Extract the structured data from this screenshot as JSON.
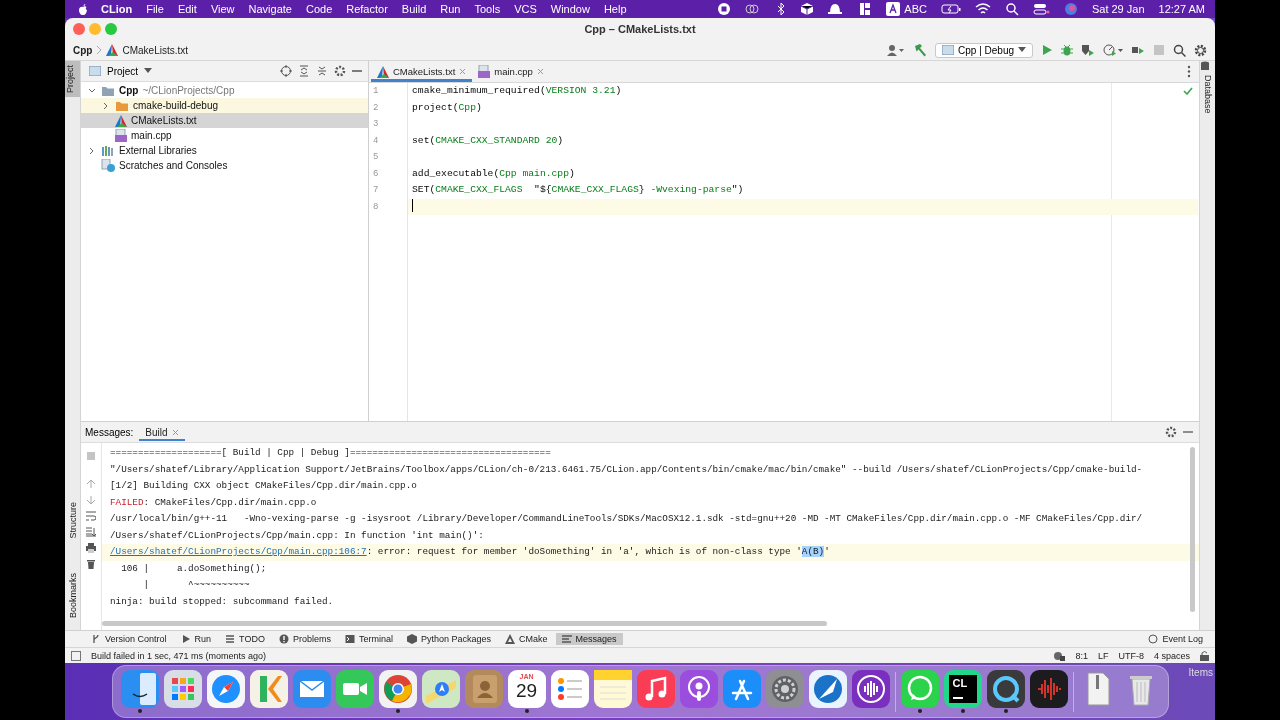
{
  "menu_bar": {
    "app_name": "CLion",
    "menus": [
      "File",
      "Edit",
      "View",
      "Navigate",
      "Code",
      "Refactor",
      "Build",
      "Run",
      "Tools",
      "VCS",
      "Window",
      "Help"
    ],
    "input_source": "ABC",
    "date": "Sat 29 Jan",
    "time": "12:27 AM"
  },
  "window": {
    "title": "Cpp – CMakeLists.txt"
  },
  "breadcrumb": [
    "Cpp",
    "CMakeLists.txt"
  ],
  "run_config": "Cpp | Debug",
  "left_stripe": {
    "top": [
      {
        "label": "Project",
        "selected": true
      }
    ],
    "bottom": [
      {
        "label": "Structure",
        "selected": false
      },
      {
        "label": "Bookmarks",
        "selected": false
      }
    ]
  },
  "right_stripe": [
    {
      "label": "Database",
      "selected": false
    }
  ],
  "project_panel": {
    "title": "Project",
    "tree": [
      {
        "label": "Cpp",
        "hint": "~/CLionProjects/Cpp",
        "kind": "folder",
        "expanded": true,
        "selected": false,
        "children": [
          {
            "label": "cmake-build-debug",
            "kind": "excluded_folder",
            "expanded": false,
            "selected": false
          },
          {
            "label": "CMakeLists.txt",
            "kind": "cmake",
            "selected": true
          },
          {
            "label": "main.cpp",
            "kind": "cpp",
            "selected": false
          }
        ]
      },
      {
        "label": "External Libraries",
        "kind": "libraries",
        "expanded": false,
        "selected": false
      },
      {
        "label": "Scratches and Consoles",
        "kind": "scratches",
        "selected": false
      }
    ]
  },
  "editor": {
    "tabs": [
      {
        "label": "CMakeLists.txt",
        "kind": "cmake",
        "selected": true
      },
      {
        "label": "main.cpp",
        "kind": "cpp",
        "selected": false
      }
    ],
    "lines": [
      {
        "number": "1",
        "current": false,
        "segments": [
          {
            "text": "cmake_minimum_required(",
            "kind": "plain"
          },
          {
            "text": "VERSION 3.21",
            "kind": "arg"
          },
          {
            "text": ")",
            "kind": "plain"
          }
        ]
      },
      {
        "number": "2",
        "current": false,
        "segments": [
          {
            "text": "project(",
            "kind": "plain"
          },
          {
            "text": "Cpp",
            "kind": "arg"
          },
          {
            "text": ")",
            "kind": "plain"
          }
        ]
      },
      {
        "number": "3",
        "current": false
      },
      {
        "number": "4",
        "current": false,
        "segments": [
          {
            "text": "set(",
            "kind": "plain"
          },
          {
            "text": "CMAKE_CXX_STANDARD 20",
            "kind": "arg"
          },
          {
            "text": ")",
            "kind": "plain"
          }
        ]
      },
      {
        "number": "5",
        "current": false
      },
      {
        "number": "6",
        "current": false,
        "segments": [
          {
            "text": "add_executable(",
            "kind": "plain"
          },
          {
            "text": "Cpp main.cpp",
            "kind": "arg"
          },
          {
            "text": ")",
            "kind": "plain"
          }
        ]
      },
      {
        "number": "7",
        "current": false,
        "segments": [
          {
            "text": "SET(",
            "kind": "plain"
          },
          {
            "text": "CMAKE_CXX_FLAGS  ",
            "kind": "arg"
          },
          {
            "text": "\"${",
            "kind": "plain"
          },
          {
            "text": "CMAKE_CXX_FLAGS",
            "kind": "arg"
          },
          {
            "text": "} ",
            "kind": "plain"
          },
          {
            "text": "-Wvexing-parse",
            "kind": "arg"
          },
          {
            "text": "\")",
            "kind": "plain"
          }
        ]
      },
      {
        "number": "8",
        "current": true
      }
    ]
  },
  "messages": {
    "label": "Messages:",
    "tabs": [
      {
        "label": "Build",
        "selected": true
      }
    ],
    "lines": [
      {
        "current": false,
        "segments": [
          {
            "text": "====================[ Build | Cpp | Debug ]====================================",
            "kind": "plain"
          }
        ]
      },
      {
        "current": false,
        "segments": [
          {
            "text": "\"/Users/shatef/Library/Application Support/JetBrains/Toolbox/apps/CLion/ch-0/213.6461.75/CLion.app/Contents/bin/cmake/mac/bin/cmake\" --build /Users/shatef/CLionProjects/Cpp/cmake-build-",
            "kind": "plain"
          }
        ]
      },
      {
        "current": false,
        "segments": [
          {
            "text": "[1/2] Building CXX object CMakeFiles/Cpp.dir/main.cpp.o",
            "kind": "plain"
          }
        ]
      },
      {
        "current": false,
        "segments": [
          {
            "text": "FAILED",
            "kind": "error"
          },
          {
            "text": ": CMakeFiles/Cpp.dir/main.cpp.o",
            "kind": "plain"
          }
        ]
      },
      {
        "current": false,
        "segments": [
          {
            "text": "/usr/local/bin/g++-11   -Wno-vexing-parse -g -isysroot /Library/Developer/CommandLineTools/SDKs/MacOSX12.1.sdk -std=gnu++20 -MD -MT CMakeFiles/Cpp.dir/main.cpp.o -MF CMakeFiles/Cpp.dir/",
            "kind": "plain"
          }
        ]
      },
      {
        "current": false,
        "segments": [
          {
            "text": "/Users/shatef/CLionProjects/Cpp/main.cpp: In function 'int main()':",
            "kind": "plain"
          }
        ]
      },
      {
        "current": true,
        "segments": [
          {
            "text": "/Users/shatef/CLionProjects/Cpp/main.cpp:106:7",
            "kind": "link"
          },
          {
            "text": ": error: request for member 'doSomething' in 'a', which is of non-class type '",
            "kind": "plain"
          },
          {
            "text": "A(B)",
            "kind": "selection"
          },
          {
            "text": "'",
            "kind": "plain"
          }
        ]
      },
      {
        "current": false,
        "segments": [
          {
            "text": "  106 |     a.doSomething();",
            "kind": "plain"
          }
        ]
      },
      {
        "current": false,
        "segments": [
          {
            "text": "      |       ^~~~~~~~~~~",
            "kind": "plain"
          }
        ]
      },
      {
        "current": false,
        "segments": [
          {
            "text": "ninja: build stopped: subcommand failed.",
            "kind": "plain"
          }
        ]
      }
    ]
  },
  "tool_windows": [
    {
      "label": "Version Control",
      "kind": "vcs",
      "selected": false
    },
    {
      "label": "Run",
      "kind": "run",
      "selected": false
    },
    {
      "label": "TODO",
      "kind": "todo",
      "selected": false
    },
    {
      "label": "Problems",
      "kind": "problems",
      "selected": false
    },
    {
      "label": "Terminal",
      "kind": "terminal",
      "selected": false
    },
    {
      "label": "Python Packages",
      "kind": "packages",
      "selected": false
    },
    {
      "label": "CMake",
      "kind": "cmake",
      "selected": false
    },
    {
      "label": "Messages",
      "kind": "messages",
      "selected": true
    }
  ],
  "event_log": "Event Log",
  "status_bar": {
    "message": "Build failed in 1 sec, 471 ms (moments ago)",
    "position": "8:1",
    "line_separator": "LF",
    "encoding": "UTF-8",
    "indent": "4 spaces"
  },
  "dock": {
    "items": [
      {
        "kind": "finder",
        "running": true
      },
      {
        "kind": "launchpad",
        "running": false
      },
      {
        "kind": "safari",
        "running": false
      },
      {
        "kind": "kite",
        "running": false
      },
      {
        "kind": "mail",
        "running": false
      },
      {
        "kind": "facetime",
        "running": false
      },
      {
        "kind": "chrome",
        "running": true
      },
      {
        "kind": "maps",
        "running": false
      },
      {
        "kind": "contacts",
        "running": false
      },
      {
        "kind": "calendar",
        "month": "JAN",
        "day": "29",
        "running": true
      },
      {
        "kind": "reminders",
        "running": false
      },
      {
        "kind": "notes",
        "running": false
      },
      {
        "kind": "music",
        "running": false
      },
      {
        "kind": "podcasts",
        "running": false
      },
      {
        "kind": "appstore",
        "running": false
      },
      {
        "kind": "settings",
        "running": false
      },
      {
        "kind": "quill",
        "running": false
      },
      {
        "kind": "audio",
        "running": false
      },
      {
        "kind": "separator"
      },
      {
        "kind": "whatsapp",
        "running": true
      },
      {
        "kind": "clion",
        "initials": "CL",
        "running": true
      },
      {
        "kind": "quicktime",
        "running": true
      },
      {
        "kind": "voicememo",
        "running": false
      },
      {
        "kind": "separator"
      },
      {
        "kind": "archive",
        "running": false
      },
      {
        "kind": "trash",
        "running": false
      }
    ]
  },
  "desktop_label": "Items"
}
